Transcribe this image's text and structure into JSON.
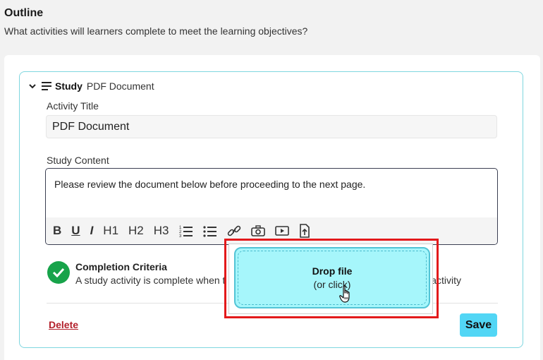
{
  "section": {
    "title": "Outline",
    "subtitle": "What activities will learners complete to meet the learning objectives?"
  },
  "activity": {
    "type_label": "Study",
    "type_name": "PDF Document",
    "title_label": "Activity Title",
    "title_value": "PDF Document",
    "content_label": "Study Content",
    "content_text": "Please review the document below before proceeding to the next page."
  },
  "toolbar": {
    "bold": "B",
    "underline": "U",
    "italic": "I",
    "h1": "H1",
    "h2": "H2",
    "h3": "H3",
    "icons": [
      "ordered-list-icon",
      "bullet-list-icon",
      "link-icon",
      "camera-icon",
      "video-icon",
      "file-upload-icon"
    ]
  },
  "criteria": {
    "title": "Completion Criteria",
    "text": "A study activity is complete when t",
    "text_suffix": "t activity"
  },
  "actions": {
    "delete_label": "Delete",
    "save_label": "Save"
  },
  "dropzone": {
    "title": "Drop file",
    "subtitle": "(or click)"
  },
  "colors": {
    "card_border": "#7fd6df",
    "save_button": "#52d6f5",
    "drop_zone": "#a6f6fb",
    "highlight": "#e3191b",
    "delete_link": "#b3202b",
    "check": "#17a34a"
  }
}
